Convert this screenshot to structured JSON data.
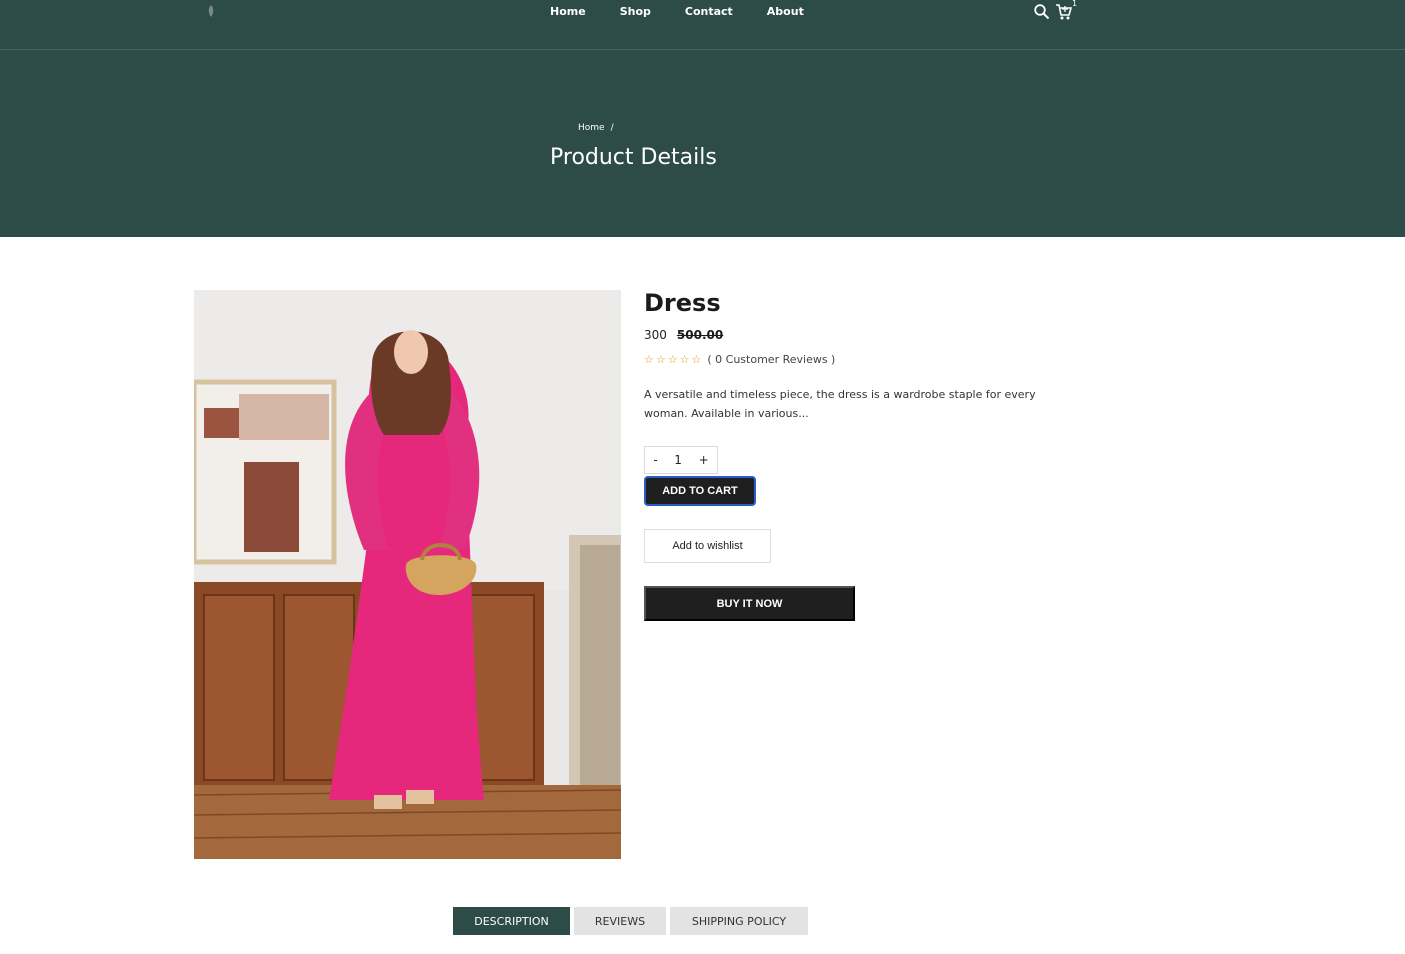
{
  "nav": {
    "items": [
      "Home",
      "Shop",
      "Contact",
      "About"
    ],
    "cart_count": "1",
    "icons": {
      "logo": "logo-icon",
      "search": "search-icon",
      "cart": "cart-icon"
    }
  },
  "hero": {
    "breadcrumb": {
      "home": "Home",
      "separator": "/"
    },
    "title": "Product Details"
  },
  "product": {
    "name": "Dress",
    "price": "300",
    "old_price": "500.00",
    "rating_stars": 0,
    "reviews_text": "( 0 Customer Reviews )",
    "description": "A versatile and timeless piece, the dress is a wardrobe staple for every woman. Available in various...",
    "quantity": {
      "minus": "-",
      "value": "1",
      "plus": "+"
    },
    "add_to_cart": "ADD TO CART",
    "add_to_wishlist": "Add to wishlist",
    "buy_now": "BUY IT NOW"
  },
  "tabs": [
    "DESCRIPTION",
    "REVIEWS",
    "SHIPPING POLICY"
  ],
  "colors": {
    "hero_bg": "#2d4b47",
    "button_dark": "#1f1f1f",
    "star": "#d6a21d",
    "tab_active": "#2d4b47"
  }
}
